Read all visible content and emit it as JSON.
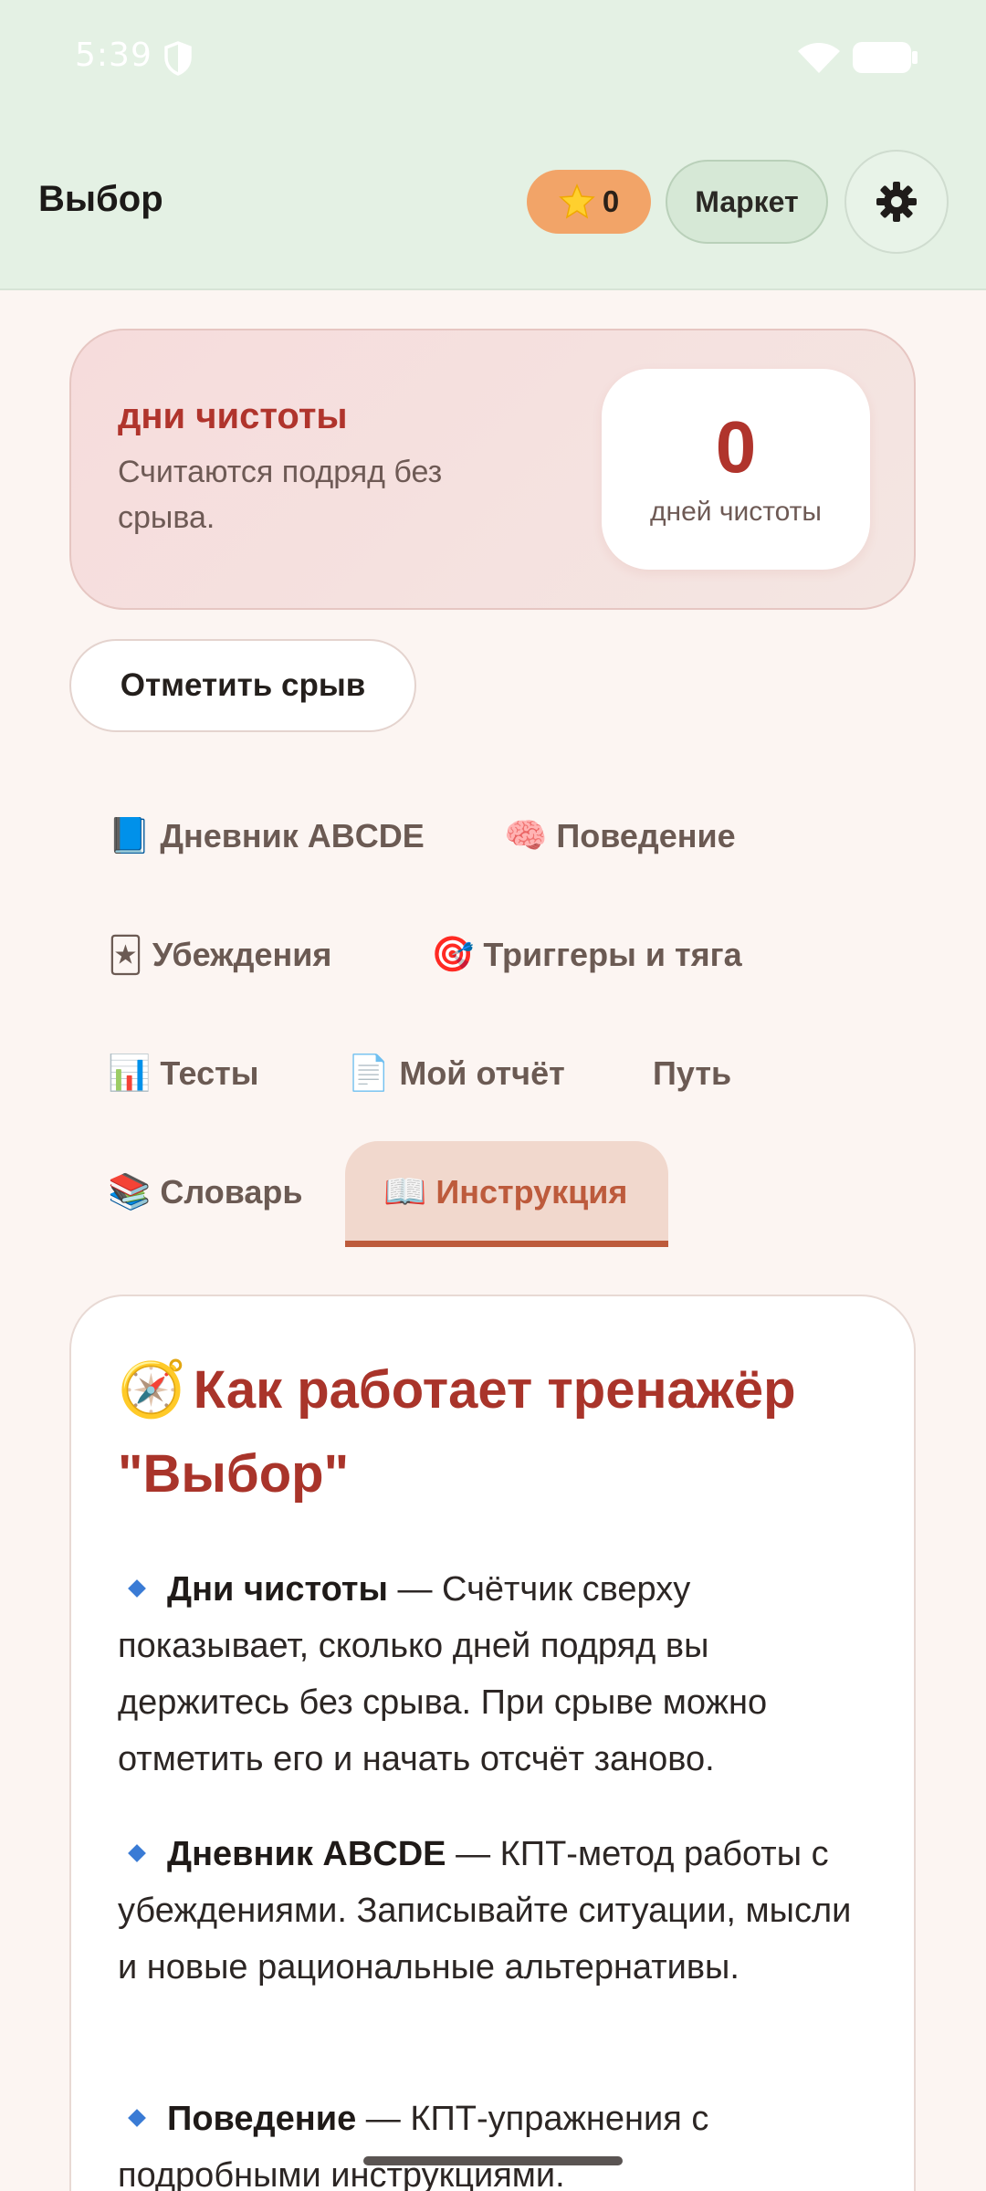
{
  "status_bar": {
    "time": "5:39",
    "icons": [
      "shield-icon",
      "wifi-icon",
      "battery-icon"
    ]
  },
  "header": {
    "title": "Выбор",
    "stars": {
      "icon": "star-icon",
      "count": "0"
    },
    "market_label": "Маркет",
    "settings_icon": "gear-icon"
  },
  "clean_card": {
    "title": "дни чистоты",
    "description": "Считаются подряд без срыва.",
    "count": "0",
    "count_label": "дней чистоты"
  },
  "relapse_button": "Отметить срыв",
  "tabs": [
    {
      "emoji": "📘",
      "label": "Дневник ABCDE"
    },
    {
      "emoji": "🧠",
      "label": "Поведение"
    },
    {
      "emoji": "🃏",
      "label": "Убеждения"
    },
    {
      "emoji": "🎯",
      "label": "Триггеры и тяга"
    },
    {
      "emoji": "📊",
      "label": "Тесты"
    },
    {
      "emoji": "📄",
      "label": "Мой отчёт"
    },
    {
      "emoji": "",
      "label": "Путь"
    },
    {
      "emoji": "📚",
      "label": "Словарь"
    },
    {
      "emoji": "📖",
      "label": "Инструкция",
      "active": true
    }
  ],
  "instructions": {
    "emoji": "🧭",
    "title": "Как работает тренажёр \"Выбор\"",
    "items": [
      {
        "term": "Дни чистоты",
        "text": " — Счётчик сверху показывает, сколько дней подряд вы держитесь без срыва. При срыве можно отметить его и начать отсчёт заново."
      },
      {
        "term": "Дневник ABCDE",
        "text": " — КПТ-метод работы с убеждениями. Записывайте ситуации, мысли и новые рациональные альтернативы."
      },
      {
        "term": "Поведение",
        "text": " — КПТ-упражнения с подробными инструкциями."
      }
    ]
  },
  "colors": {
    "header_bg": "#e4f1e4",
    "accent_red": "#b0342c",
    "tab_active": "#bd5b3c",
    "star_pill": "#f2a468"
  }
}
